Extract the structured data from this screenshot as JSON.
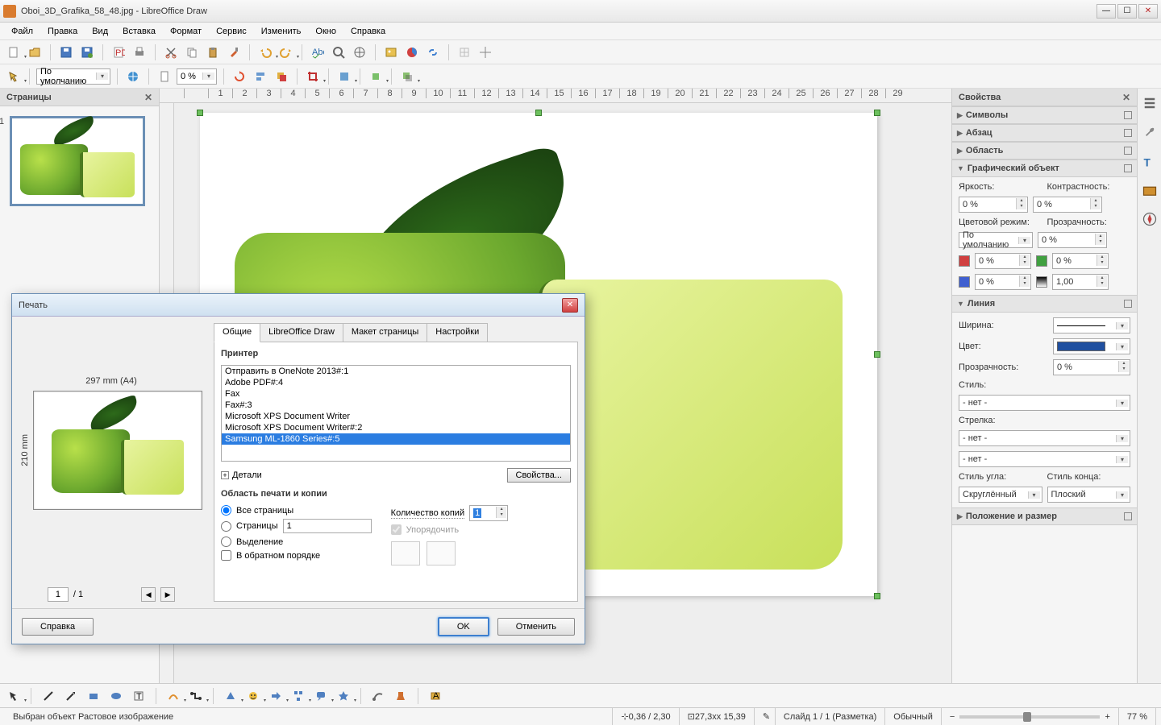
{
  "titlebar": {
    "text": "Oboi_3D_Grafika_58_48.jpg - LibreOffice Draw"
  },
  "menu": [
    "Файл",
    "Правка",
    "Вид",
    "Вставка",
    "Формат",
    "Сервис",
    "Изменить",
    "Окно",
    "Справка"
  ],
  "toolbar2": {
    "style_combo": "По умолчанию",
    "zoom_pct": "0 %"
  },
  "pages_panel": {
    "title": "Страницы",
    "slide_num": "1"
  },
  "ruler_ticks": [
    " ",
    "1",
    "2",
    "3",
    "4",
    "5",
    "6",
    "7",
    "8",
    "9",
    "10",
    "11",
    "12",
    "13",
    "14",
    "15",
    "16",
    "17",
    "18",
    "19",
    "20",
    "21",
    "22",
    "23",
    "24",
    "25",
    "26",
    "27",
    "28",
    "29"
  ],
  "props_panel": {
    "title": "Свойства",
    "sections": {
      "symbols": "Символы",
      "paragraph": "Абзац",
      "area": "Область",
      "graphic": "Графический объект",
      "line": "Линия",
      "pos_size": "Положение и размер"
    },
    "graphic": {
      "brightness_label": "Яркость:",
      "contrast_label": "Контрастность:",
      "brightness": "0 %",
      "contrast": "0 %",
      "color_mode_label": "Цветовой режим:",
      "color_mode": "По умолчанию",
      "transp_label": "Прозрачность:",
      "transp": "0 %",
      "red": "0 %",
      "green": "0 %",
      "blue": "0 %",
      "gamma": "1,00"
    },
    "line": {
      "width_label": "Ширина:",
      "color_label": "Цвет:",
      "transp_label": "Прозрачность:",
      "transp": "0 %",
      "style_label": "Стиль:",
      "style": "- нет -",
      "arrow_label": "Стрелка:",
      "arrow1": "- нет -",
      "arrow2": "- нет -",
      "corner_style_label": "Стиль угла:",
      "corner_style": "Скруглённый",
      "cap_style_label": "Стиль конца:",
      "cap_style": "Плоский"
    }
  },
  "dialog": {
    "title": "Печать",
    "tabs": [
      "Общие",
      "LibreOffice Draw",
      "Макет страницы",
      "Настройки"
    ],
    "active_tab": 0,
    "printer_section": "Принтер",
    "printers": [
      "Отправить в OneNote 2013#:1",
      "Adobe PDF#:4",
      "Fax",
      "Fax#:3",
      "Microsoft XPS Document Writer",
      "Microsoft XPS Document Writer#:2",
      "Samsung ML-1860 Series#:5"
    ],
    "selected_printer": 6,
    "details": "Детали",
    "props_btn": "Свойства...",
    "range_section": "Область печати и копии",
    "r_all": "Все страницы",
    "r_pages": "Страницы",
    "r_pages_val": "1",
    "r_selection": "Выделение",
    "reverse": "В обратном порядке",
    "copies_label": "Количество копий",
    "copies": "1",
    "collate": "Упорядочить",
    "preview_top": "297 mm (A4)",
    "preview_side": "210 mm",
    "pager_current": "1",
    "pager_total": "/ 1",
    "help_btn": "Справка",
    "ok_btn": "OK",
    "cancel_btn": "Отменить"
  },
  "draw_toolbar_icons": [
    "pointer",
    "line",
    "arrow-end",
    "rect",
    "ellipse",
    "text",
    "curve",
    "connector",
    "shapes",
    "symbol",
    "arrows-block",
    "flow",
    "callout",
    "star",
    "pencil",
    "bucket",
    "frame"
  ],
  "status": {
    "selection": "Выбран объект Растовое изображение",
    "pos": "0,36 / 2,30",
    "size": "27,3xx 15,39",
    "slide": "Слайд 1 / 1 (Разметка)",
    "style": "Обычный",
    "zoom": "77 %"
  }
}
